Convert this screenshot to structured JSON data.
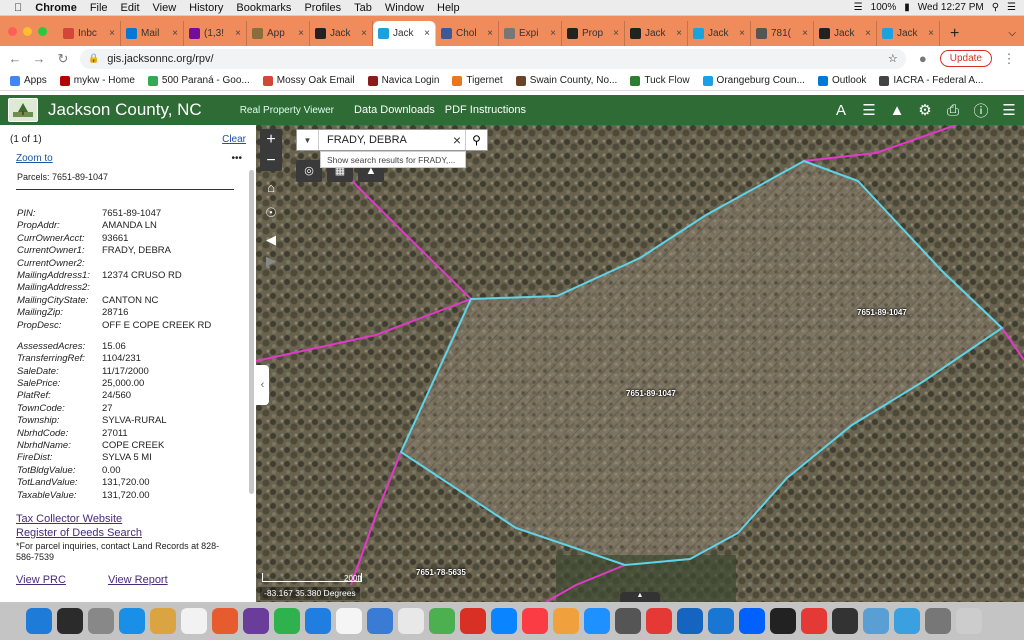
{
  "mac_menu": {
    "app_name": "Chrome",
    "items": [
      "File",
      "Edit",
      "View",
      "History",
      "Bookmarks",
      "Profiles",
      "Tab",
      "Window",
      "Help"
    ],
    "battery": "100%",
    "clock": "Wed 12:27 PM"
  },
  "tabs": [
    {
      "label": "Inbc",
      "color": "#d44638"
    },
    {
      "label": "Mail",
      "color": "#0078d4"
    },
    {
      "label": "(1,3!",
      "color": "#720e9e"
    },
    {
      "label": "App",
      "color": "#8a6d3b"
    },
    {
      "label": "Jack",
      "color": "#222222"
    },
    {
      "label": "Jack",
      "color": "#1ba1e2",
      "active": true
    },
    {
      "label": "Chol",
      "color": "#3b5998"
    },
    {
      "label": "Expi",
      "color": "#777777"
    },
    {
      "label": "Prop",
      "color": "#222222"
    },
    {
      "label": "Jack",
      "color": "#222222"
    },
    {
      "label": "Jack",
      "color": "#1ba1e2"
    },
    {
      "label": "781(",
      "color": "#555555"
    },
    {
      "label": "Jack",
      "color": "#222222"
    },
    {
      "label": "Jack",
      "color": "#1ba1e2"
    }
  ],
  "browser": {
    "url": "gis.jacksonnc.org/rpv/",
    "update_label": "Update"
  },
  "bookmarks": [
    {
      "label": "Apps",
      "color": "#4285f4"
    },
    {
      "label": "mykw - Home",
      "color": "#b40101"
    },
    {
      "label": "500 Paraná - Goo...",
      "color": "#34a853"
    },
    {
      "label": "Mossy Oak Email",
      "color": "#d44638"
    },
    {
      "label": "Navica Login",
      "color": "#8b1a1a"
    },
    {
      "label": "Tigernet",
      "color": "#e87722"
    },
    {
      "label": "Swain County, No...",
      "color": "#6b4226"
    },
    {
      "label": "Tuck Flow",
      "color": "#2e7d32"
    },
    {
      "label": "Orangeburg Coun...",
      "color": "#1ba1e2"
    },
    {
      "label": "Outlook",
      "color": "#0078d4"
    },
    {
      "label": "IACRA - Federal A...",
      "color": "#444444"
    }
  ],
  "header": {
    "county": "Jackson County, NC",
    "subtitle": "Real Property Viewer",
    "link1": "Data Downloads",
    "link2": "PDF Instructions"
  },
  "panel": {
    "count": "(1 of 1)",
    "clear": "Clear",
    "zoom": "Zoom to",
    "more": "•••",
    "parcels": "Parcels: 7651-89-1047",
    "group1": [
      {
        "k": "PIN:",
        "v": "7651-89-1047"
      },
      {
        "k": "PropAddr:",
        "v": "AMANDA LN"
      },
      {
        "k": "CurrOwnerAcct:",
        "v": "93661"
      },
      {
        "k": "CurrentOwner1:",
        "v": "FRADY, DEBRA"
      },
      {
        "k": "CurrentOwner2:",
        "v": ""
      },
      {
        "k": "MailingAddress1:",
        "v": "12374 CRUSO RD"
      },
      {
        "k": "MailingAddress2:",
        "v": ""
      },
      {
        "k": "MailingCityState:",
        "v": "CANTON NC"
      },
      {
        "k": "MailingZip:",
        "v": "28716"
      },
      {
        "k": "PropDesc:",
        "v": "OFF E COPE CREEK RD"
      }
    ],
    "group2": [
      {
        "k": "AssessedAcres:",
        "v": "15.06"
      },
      {
        "k": "TransferringRef:",
        "v": "1104/231"
      },
      {
        "k": "SaleDate:",
        "v": "11/17/2000"
      },
      {
        "k": "SalePrice:",
        "v": "25,000.00"
      },
      {
        "k": "PlatRef:",
        "v": "24/560"
      },
      {
        "k": "TownCode:",
        "v": "27"
      },
      {
        "k": "Township:",
        "v": "SYLVA-RURAL"
      },
      {
        "k": "NbrhdCode:",
        "v": "27011"
      },
      {
        "k": "NbrhdName:",
        "v": "COPE CREEK"
      },
      {
        "k": "FireDist:",
        "v": "SYLVA 5 MI"
      },
      {
        "k": "TotBldgValue:",
        "v": "0.00"
      },
      {
        "k": "TotLandValue:",
        "v": "131,720.00"
      },
      {
        "k": "TaxableValue:",
        "v": "131,720.00"
      }
    ],
    "tax_link": "Tax Collector Website",
    "deeds_link": "Register of Deeds Search",
    "note": "*For parcel inquiries, contact Land Records at 828-586-7539",
    "prc_link": "View PRC",
    "report_link": "View Report"
  },
  "map": {
    "search_value": "FRADY, DEBRA",
    "suggestion": "Show search results for FRADY,...",
    "labels": [
      "7651-89-1047",
      "7651-89-1047",
      "7651-78-5635"
    ],
    "coords": "-83.167 35.380 Degrees",
    "scale": "200ft",
    "parcel_color": "#5fd3e8",
    "boundary_color": "#e03ac8"
  },
  "dock_colors": [
    "#1e7bd8",
    "#2b2b2b",
    "#888888",
    "#1a8fe8",
    "#d9a441",
    "#f2f2f2",
    "#e65c2e",
    "#6a3d9a",
    "#2fb24d",
    "#1f7ee0",
    "#f5f5f5",
    "#3a7bd5",
    "#e8e8e8",
    "#4caf50",
    "#d93025",
    "#0b84ff",
    "#fc3c44",
    "#f0a03c",
    "#1e90ff",
    "#555555",
    "#e53935",
    "#1565c0",
    "#1976d2",
    "#0061fe",
    "#222222",
    "#e53935",
    "#333333",
    "#5a9fd4",
    "#3aa0e0",
    "#777777",
    "#cccccc"
  ]
}
